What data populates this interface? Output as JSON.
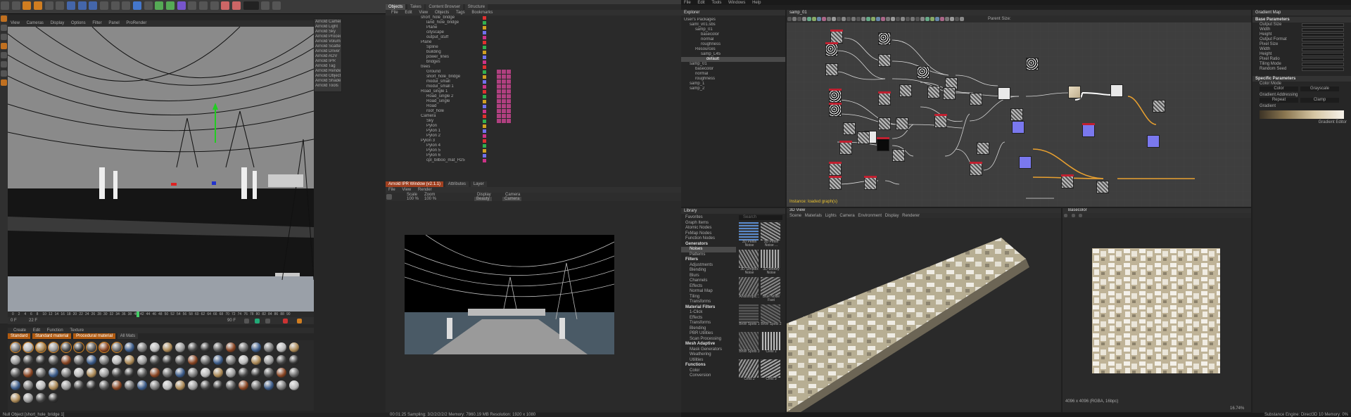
{
  "cinema4d": {
    "top_menu": [
      "File",
      "Edit",
      "View",
      "Objects",
      "Tags",
      "Bookmarks"
    ],
    "viewport_menu": [
      "View",
      "Cameras",
      "Display",
      "Options",
      "Filter",
      "Panel",
      "ProRender"
    ],
    "viewport_label": "Perspective",
    "arnold_menu": [
      "Arnold Camera",
      "Arnold Light",
      "Arnold Sky",
      "Arnold Procedural",
      "Arnold Volume",
      "Arnold Scatter",
      "Arnold Driver",
      "Arnold AOV",
      "Arnold IPR",
      "Arnold Tag",
      "Arnold Render",
      "Arnold Object",
      "Arnold Shader",
      "Arnold Tools"
    ],
    "objects_tabs": [
      "Objects",
      "Takes",
      "Content Browser",
      "Structure"
    ],
    "objects_menu": [
      "File",
      "Edit",
      "View",
      "Objects",
      "Tags",
      "Bookmarks"
    ],
    "objects": [
      "short_hole_bridge",
      "land_hole_bridge",
      "Plane",
      "cityscape",
      "output_stuff",
      "Plane",
      "Spline",
      "building",
      "power_lines",
      "bridges",
      "trees",
      "Ground",
      "short_hole_bridge",
      "modul_small",
      "modul_small 1",
      "Road_single 1",
      "Road_single 2",
      "Road_single",
      "Road",
      "roof_hole",
      "Camera",
      "Sky",
      "Pylon",
      "Pylon 1",
      "Pylon 2",
      "Pylon 3",
      "Pylon 4",
      "Pylon 5",
      "Pylon 6",
      "cpl_bilboo_mat_H25"
    ],
    "ipr_tabs": [
      "Arnold IPR Window (v2.1.1)",
      "Attributes",
      "Layer"
    ],
    "ipr_menu": [
      "File",
      "View",
      "Render"
    ],
    "ipr_toolbar": [
      "Scale",
      "100 %",
      "Zoom",
      "100 %",
      "Camera",
      "Camera",
      "Display",
      "Beauty",
      "Scene"
    ],
    "timeline": {
      "start": "0 F",
      "end": "90 F",
      "ticks": [
        "0",
        "2",
        "4",
        "6",
        "8",
        "10",
        "12",
        "14",
        "16",
        "18",
        "20",
        "22",
        "24",
        "26",
        "28",
        "30",
        "32",
        "34",
        "36",
        "38",
        "40",
        "42",
        "44",
        "46",
        "48",
        "50",
        "52",
        "54",
        "56",
        "58",
        "60",
        "62",
        "64",
        "66",
        "68",
        "70",
        "72",
        "74",
        "76",
        "78",
        "80",
        "82",
        "84",
        "86",
        "88",
        "90"
      ],
      "current": "22 F"
    },
    "material_menu": [
      "Create",
      "Edit",
      "Function",
      "Texture"
    ],
    "material_tabs": [
      "Standard",
      "Standard material",
      "Procedural material",
      "All Mats"
    ],
    "status_bar": "Null Object [short_hole_bridge 1]",
    "ipr_status": "00:01:25  Sampling: 3/2/2/2/2/2  Memory: 7860.19 MB  Resolution: 1920 x 1080"
  },
  "designer": {
    "top_menu": [
      "File",
      "Edit",
      "Tools",
      "Windows",
      "Help"
    ],
    "explorer": {
      "title": "Explorer",
      "items": [
        "User's Packages",
        "saml_v01.sbs",
        "samp_01",
        "basecolor",
        "normal",
        "roughness",
        "Resources",
        "samp_L45",
        "default",
        "samp_01",
        "basecolor",
        "normal",
        "roughness",
        "samp_1",
        "samp_2"
      ]
    },
    "graph": {
      "title": "samp_01",
      "toolbar_label": "Parent Size:",
      "footer": "Instance: loaded graph(s)"
    },
    "library": {
      "title": "Library",
      "search_placeholder": "Search",
      "categories": [
        "Favorites",
        "Graph Items",
        "Atomic Nodes",
        "FxMap Nodes",
        "Function Nodes",
        "Generators",
        "Noises",
        "Patterns",
        "Filters",
        "Adjustments",
        "Blending",
        "Blurs",
        "Channels",
        "Effects",
        "Normal Map",
        "Tiling",
        "Transforms",
        "Material Filters",
        "1-Click",
        "Effects",
        "Transforms",
        "Blending",
        "PBR Utilities",
        "Scan Processing",
        "Mesh Adaptive",
        "Mask Generators",
        "Weathering",
        "Utilities",
        "Functions",
        "Color",
        "Conversion"
      ],
      "thumbs": [
        "3D Perlin Noise",
        "3D Perlin Noise ...",
        "3D Simplex Noise",
        "3D Worley Noise",
        "Anisotropic...",
        "Blue Noise Fast",
        "BnW Spots 1",
        "BnW Spots 2",
        "BnW Spots 3",
        "Cells 1",
        "Cells 2",
        "Cells 3"
      ]
    },
    "view3d": {
      "title": "3D View",
      "menu": [
        "Scene",
        "Materials",
        "Lights",
        "Camera",
        "Environment",
        "Display",
        "Renderer"
      ]
    },
    "view2d": {
      "title": "Basecolor",
      "status": "4096 x 4096 (RGBA, 16bpc)",
      "zoom": "16.74%"
    },
    "properties": {
      "title": "Gradient Map",
      "sections": [
        {
          "name": "Base Parameters",
          "rows": [
            "Output Size",
            "Width",
            "Height",
            "Output Format",
            "Pixel Size",
            "Width",
            "Height",
            "Pixel Ratio",
            "Tiling Mode",
            "Random Seed"
          ]
        },
        {
          "name": "Specific Parameters",
          "rows": [
            "Color Mode",
            "Gradient Addressing",
            "Gradient"
          ]
        }
      ],
      "color_mode_options": [
        "Color",
        "Grayscale"
      ],
      "addressing_options": [
        "Repeat",
        "Clamp"
      ],
      "gradient_button": "Gradient Editor"
    },
    "status_bar": "Substance Engine: Direct3D 10  Memory: 0%"
  },
  "colors": {
    "accent": "#f0a020",
    "node_purple": "#7a78ee",
    "node_red": "#c02030",
    "selection": "#3a6ea5"
  }
}
